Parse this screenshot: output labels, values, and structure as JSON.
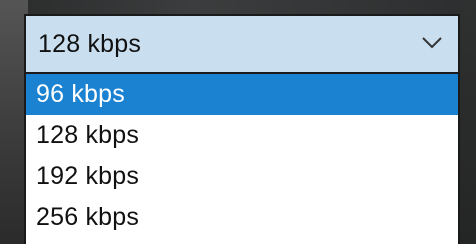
{
  "combo": {
    "value": "128 kbps",
    "expanded": true
  },
  "dropdown": {
    "options": [
      {
        "label": "96 kbps",
        "highlighted": true
      },
      {
        "label": "128 kbps",
        "highlighted": false
      },
      {
        "label": "192 kbps",
        "highlighted": false
      },
      {
        "label": "256 kbps",
        "highlighted": false
      }
    ]
  },
  "colors": {
    "combo_bg": "#c9dff0",
    "highlight": "#1b82d1",
    "list_bg": "#ffffff"
  },
  "icons": {
    "chevron": "chevron-down-icon"
  }
}
